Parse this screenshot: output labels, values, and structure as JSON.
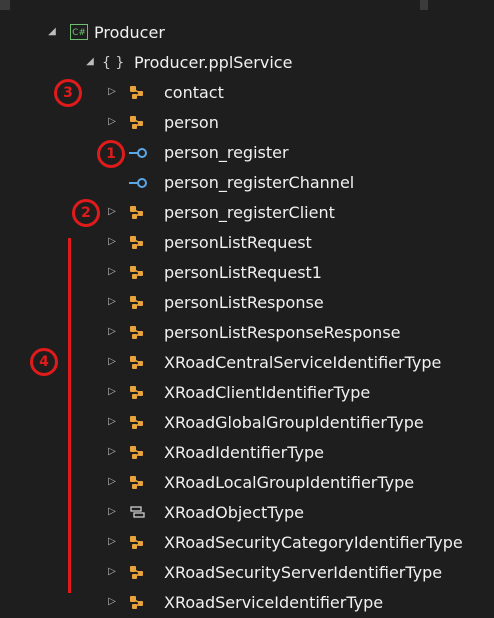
{
  "tree": {
    "root": {
      "badge": "C#",
      "label": "Producer"
    },
    "namespace": {
      "brace": "{ }",
      "label": "Producer.pplService"
    },
    "items": [
      {
        "label": "contact",
        "kind": "class",
        "expandable": true
      },
      {
        "label": "person",
        "kind": "class",
        "expandable": true
      },
      {
        "label": "person_register",
        "kind": "interface",
        "expandable": false
      },
      {
        "label": "person_registerChannel",
        "kind": "interface",
        "expandable": false
      },
      {
        "label": "person_registerClient",
        "kind": "class",
        "expandable": true
      },
      {
        "label": "personListRequest",
        "kind": "class",
        "expandable": true
      },
      {
        "label": "personListRequest1",
        "kind": "class",
        "expandable": true
      },
      {
        "label": "personListResponse",
        "kind": "class",
        "expandable": true
      },
      {
        "label": "personListResponseResponse",
        "kind": "class",
        "expandable": true
      },
      {
        "label": "XRoadCentralServiceIdentifierType",
        "kind": "class",
        "expandable": true
      },
      {
        "label": "XRoadClientIdentifierType",
        "kind": "class",
        "expandable": true
      },
      {
        "label": "XRoadGlobalGroupIdentifierType",
        "kind": "class",
        "expandable": true
      },
      {
        "label": "XRoadIdentifierType",
        "kind": "class",
        "expandable": true
      },
      {
        "label": "XRoadLocalGroupIdentifierType",
        "kind": "class",
        "expandable": true
      },
      {
        "label": "XRoadObjectType",
        "kind": "enum",
        "expandable": true
      },
      {
        "label": "XRoadSecurityCategoryIdentifierType",
        "kind": "class",
        "expandable": true
      },
      {
        "label": "XRoadSecurityServerIdentifierType",
        "kind": "class",
        "expandable": true
      },
      {
        "label": "XRoadServiceIdentifierType",
        "kind": "class",
        "expandable": true
      }
    ]
  },
  "annotations": {
    "a1": "1",
    "a2": "2",
    "a3": "3",
    "a4": "4"
  },
  "colors": {
    "background": "#1e1e1e",
    "text": "#f1f1f1",
    "class_icon": "#e8a33d",
    "interface_icon": "#5aa7e6",
    "annotation": "#e11b1b"
  }
}
